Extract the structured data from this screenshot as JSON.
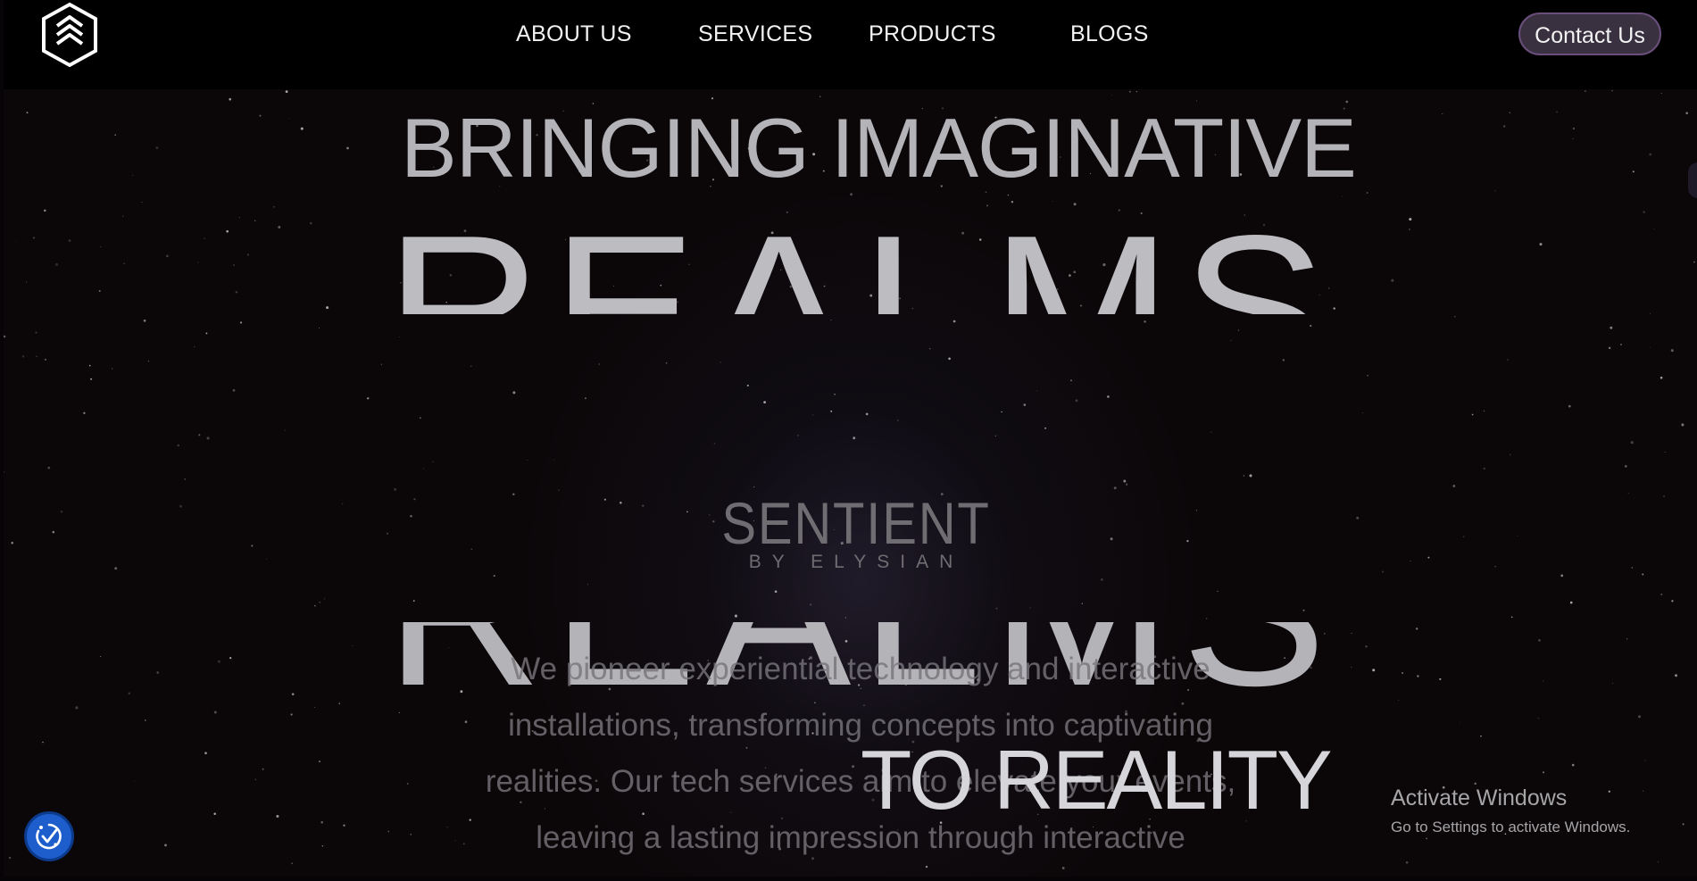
{
  "header": {
    "logo_icon": "hexagon-chevrons-logo-icon",
    "nav": [
      {
        "label": "ABOUT US"
      },
      {
        "label": "SERVICES"
      },
      {
        "label": "PRODUCTS"
      },
      {
        "label": "BLOGS"
      }
    ],
    "contact_label": "Contact Us"
  },
  "hero": {
    "line1": "BRINGING IMAGINATIVE",
    "line2": "REALMS",
    "line3": "TO REALITY",
    "brand_name": "SENTIENT",
    "brand_sub": "BY ELYSIAN",
    "description": [
      "We pioneer experiential technology and interactive",
      "installations, transforming concepts into captivating",
      "realities. Our tech services aim to elevate your events,",
      "leaving a lasting impression through interactive"
    ]
  },
  "os_watermark": {
    "title": "Activate Windows",
    "subtitle": "Go to Settings to activate Windows."
  },
  "accessibility_icon": "accessibility-check-icon",
  "colors": {
    "background": "#0b0709",
    "header": "#000000",
    "headline": "#b4b3b7",
    "contact_button": "#3a3140",
    "contact_border": "#6a4e7c",
    "accessibility_button": "#1d5ecc"
  }
}
